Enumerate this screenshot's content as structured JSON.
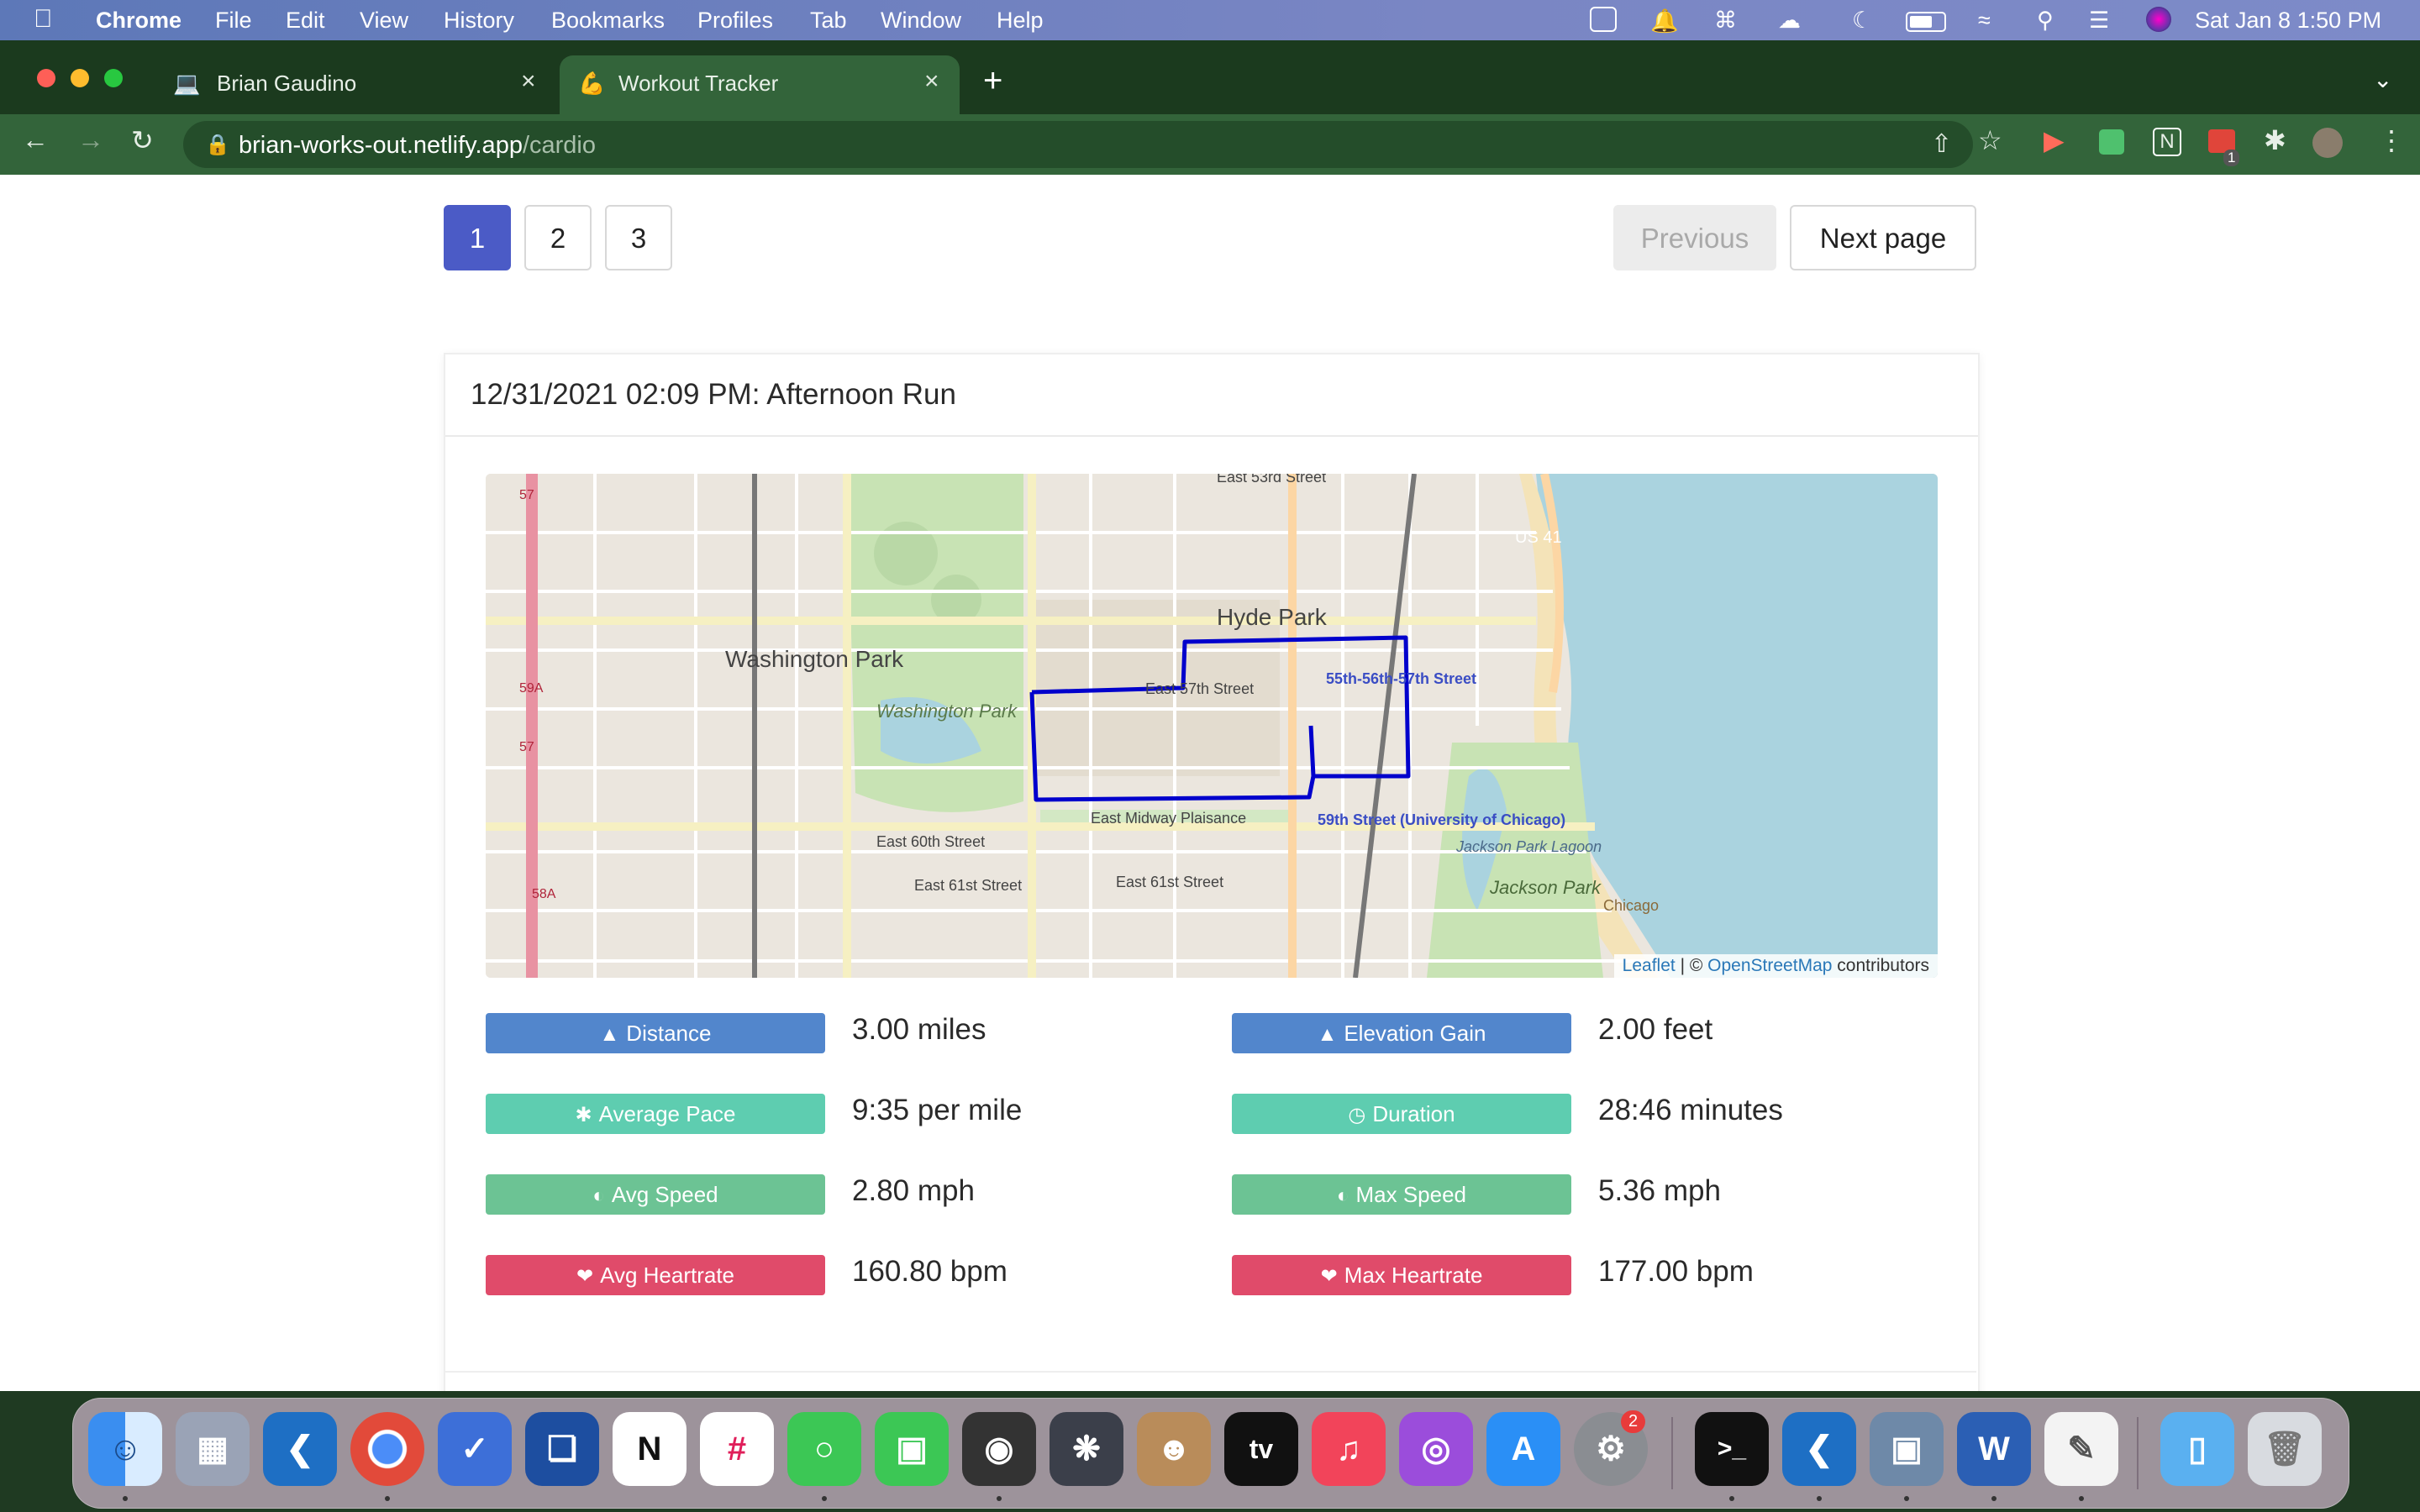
{
  "menubar": {
    "app": "Chrome",
    "items": [
      "File",
      "Edit",
      "View",
      "History",
      "Bookmarks",
      "Profiles",
      "Tab",
      "Window",
      "Help"
    ],
    "datetime": "Sat Jan 8  1:50 PM"
  },
  "browser": {
    "tabs": [
      {
        "title": "Brian Gaudino",
        "active": false
      },
      {
        "title": "Workout Tracker",
        "active": true
      }
    ],
    "new_tab_symbol": "+",
    "url_domain": "brian-works-out.netlify.app",
    "url_path": "/cardio",
    "extension_badge": "1"
  },
  "pagination": {
    "pages": [
      "1",
      "2",
      "3"
    ],
    "active_page": "1",
    "previous_label": "Previous",
    "next_label": "Next page"
  },
  "activity": {
    "title": "12/31/2021 02:09 PM: Afternoon Run",
    "map": {
      "labels": {
        "hyde_park": "Hyde Park",
        "washington_park": "Washington Park",
        "washington_park_2": "Washington Park",
        "e53": "East 53rd Street",
        "e57": "East 57th Street",
        "e60": "East 60th Street",
        "e61a": "East 61st Street",
        "e61b": "East 61st Street",
        "midway": "East Midway Plaisance",
        "st5557": "55th-56th-57th Street",
        "st59": "59th Street (University of Chicago)",
        "jackson": "Jackson Park",
        "jackson_lagoon": "Jackson Park Lagoon",
        "us41": "US 41",
        "r57": "57",
        "r59a": "59A",
        "r58a": "58A",
        "r57b": "57",
        "chicago": "Chicago"
      },
      "attribution_leaflet": "Leaflet",
      "attribution_sep": " | © ",
      "attribution_osm": "OpenStreetMap",
      "attribution_tail": " contributors",
      "route_color": "#0000cc"
    },
    "stats": [
      {
        "label": "Distance",
        "value": "3.00 miles",
        "icon": "road-icon",
        "color": "#5286cc"
      },
      {
        "label": "Elevation Gain",
        "value": "2.00 feet",
        "icon": "mountain-icon",
        "color": "#5286cc"
      },
      {
        "label": "Average Pace",
        "value": "9:35 per mile",
        "icon": "running-icon",
        "color": "#5ecdb0"
      },
      {
        "label": "Duration",
        "value": "28:46 minutes",
        "icon": "clock-icon",
        "color": "#5ecdb0"
      },
      {
        "label": "Avg Speed",
        "value": "2.80 mph",
        "icon": "speedometer-icon",
        "color": "#6cc394"
      },
      {
        "label": "Max Speed",
        "value": "5.36 mph",
        "icon": "speedometer-icon",
        "color": "#6cc394"
      },
      {
        "label": "Avg Heartrate",
        "value": "160.80 bpm",
        "icon": "heart-icon",
        "color": "#e04b6a"
      },
      {
        "label": "Max Heartrate",
        "value": "177.00 bpm",
        "icon": "heart-icon",
        "color": "#e04b6a"
      }
    ]
  },
  "dock": {
    "apps": [
      "Finder",
      "Launchpad",
      "Visual Studio Code",
      "Google Chrome",
      "Things",
      "Screens",
      "Notion",
      "Slack",
      "Messages",
      "FaceTime",
      "Aperture",
      "DaVinci Resolve",
      "Contacts",
      "Apple TV",
      "Music",
      "Podcasts",
      "App Store",
      "System Preferences",
      "Terminal",
      "Visual Studio Code",
      "Preview",
      "Microsoft Word",
      "TextEdit",
      "Downloads",
      "Trash"
    ],
    "settings_badge": "2",
    "tv_label": "tv"
  }
}
